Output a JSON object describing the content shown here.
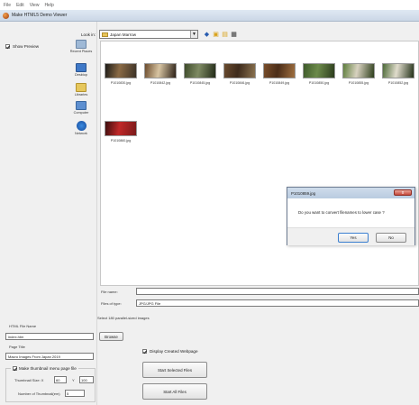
{
  "menu": [
    "File",
    "Edit",
    "View",
    "Help"
  ],
  "window": {
    "title": "Make HTML5 Demo Viewer"
  },
  "left": {
    "show_preview_label": "Show Preview",
    "show_preview_checked": true
  },
  "lookin": {
    "label": "Look in:",
    "value": "Japan Marrow"
  },
  "places": [
    "Recent Places",
    "Desktop",
    "Libraries",
    "Computer",
    "Network"
  ],
  "files": [
    {
      "name": "P1010830.jpg"
    },
    {
      "name": "P1010842.jpg"
    },
    {
      "name": "P1010845.jpg"
    },
    {
      "name": "P1010846.jpg"
    },
    {
      "name": "P1010849.jpg"
    },
    {
      "name": "P1010850.jpg"
    },
    {
      "name": "P1010855.jpg"
    },
    {
      "name": "P1010852.jpg"
    },
    {
      "name": "P1010860.jpg"
    }
  ],
  "thumb_colors": [
    [
      "#1b1a18",
      "#8a6a45",
      "#3c3227"
    ],
    [
      "#6b4b2c",
      "#d7c4a2",
      "#2b2016"
    ],
    [
      "#3d4a2a",
      "#7e8a63",
      "#222a18"
    ],
    [
      "#6a4b2e",
      "#3e2b1c",
      "#8b7350"
    ],
    [
      "#7a4e2a",
      "#4b2d18",
      "#a07040"
    ],
    [
      "#3e5a2a",
      "#6c8a4a",
      "#2b3b1c"
    ],
    [
      "#5e7d3c",
      "#d8d2c0",
      "#2c3d1a"
    ],
    [
      "#4d6a38",
      "#e0dccc",
      "#223018"
    ],
    [
      "#3a0d0d",
      "#c02828",
      "#7a1a1a"
    ]
  ],
  "fields": {
    "file_name_label": "File name:",
    "file_type_label": "Files of type:",
    "file_type_value": "JPG/JPG File"
  },
  "select_note": "Select 180 parallel-sized images",
  "html_file_name": {
    "group_label": "HTML File Name",
    "value": "index.htm",
    "browse_label": "Browse"
  },
  "page_title": {
    "group_label": "Page Title",
    "value": "Macro Images From Japan 2019"
  },
  "thumbnail": {
    "make_label": "Make thumbnail menu page file",
    "make_checked": true,
    "size_label": "Thumbnail Size: X",
    "x_value": "60",
    "y_label": "Y",
    "y_value": "100",
    "count_label": "Number of Thumbnail(em)",
    "count_value": "5"
  },
  "display_created_label": "Display Created Webpage",
  "display_created_checked": true,
  "buttons": {
    "start_selected": "Start Selected Files",
    "start_all": "Start All Files"
  },
  "msgbox": {
    "title": "P1010859.jpg",
    "close": "x",
    "message": "Do you want to convert filenames to lower case ?",
    "yes": "Yes",
    "no": "No"
  }
}
